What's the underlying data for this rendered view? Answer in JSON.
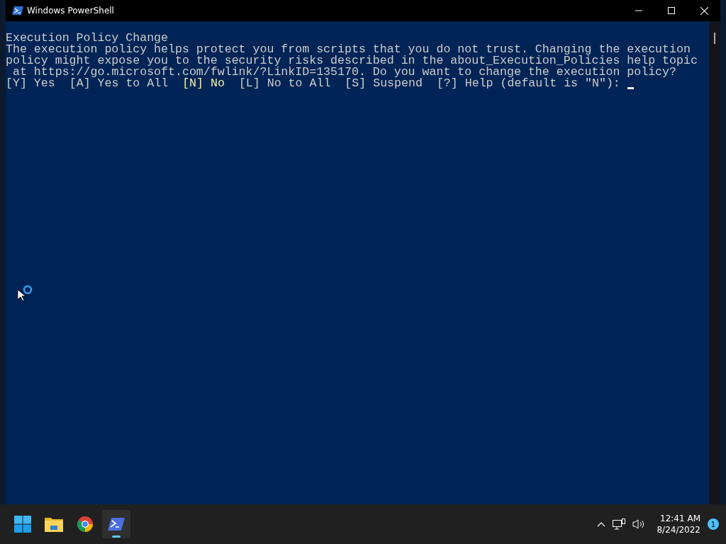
{
  "window": {
    "title": "Windows PowerShell"
  },
  "console": {
    "heading": "Execution Policy Change",
    "lines": [
      "The execution policy helps protect you from scripts that you do not trust. Changing the execution",
      "policy might expose you to the security risks described in the about_Execution_Policies help topic",
      " at https://go.microsoft.com/fwlink/?LinkID=135170. Do you want to change the execution policy?"
    ],
    "options": [
      {
        "text": "[Y] Yes",
        "default": false
      },
      {
        "text": "[A] Yes to All",
        "default": false
      },
      {
        "text": "[N] No",
        "default": true
      },
      {
        "text": "[L] No to All",
        "default": false
      },
      {
        "text": "[S] Suspend",
        "default": false
      },
      {
        "text": "[?] Help (default is \"N\"):",
        "default": false
      }
    ]
  },
  "taskbar": {
    "apps": [
      {
        "kind": "start",
        "selected": false
      },
      {
        "kind": "explorer",
        "selected": false
      },
      {
        "kind": "chrome",
        "selected": false
      },
      {
        "kind": "powershell",
        "selected": true
      }
    ],
    "time": "12:41 AM",
    "date": "8/24/2022",
    "notifications": "1"
  }
}
